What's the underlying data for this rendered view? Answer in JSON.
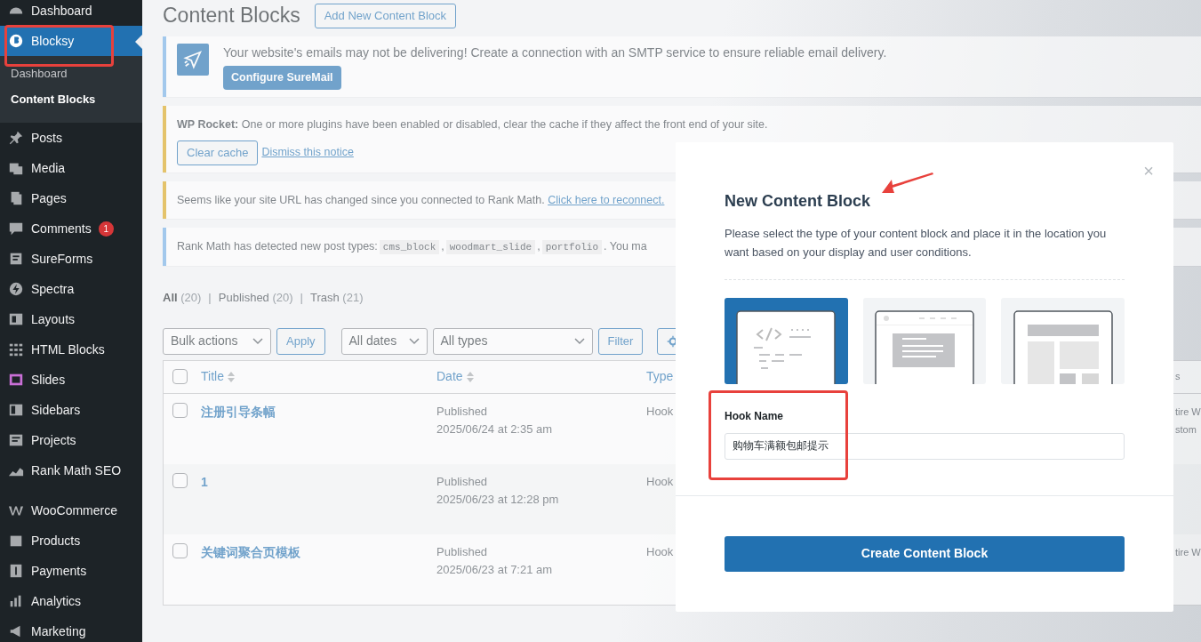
{
  "sidebar": {
    "menu_groups": [
      [
        {
          "label": "Dashboard",
          "selected": false,
          "highlighted": false
        },
        {
          "label": "Blocksy",
          "selected": true,
          "highlighted": true,
          "children": [
            {
              "label": "Dashboard",
              "selected": false
            },
            {
              "label": "Content Blocks",
              "selected": true
            }
          ]
        },
        {
          "label": "Posts",
          "selected": false,
          "highlighted": false
        },
        {
          "label": "Media",
          "selected": false,
          "highlighted": false
        },
        {
          "label": "Pages",
          "selected": false,
          "highlighted": false
        },
        {
          "label": "Comments",
          "selected": false,
          "highlighted": false,
          "badge": "1"
        },
        {
          "label": "SureForms",
          "selected": false,
          "highlighted": false
        },
        {
          "label": "Spectra",
          "selected": false,
          "highlighted": false
        },
        {
          "label": "Layouts",
          "selected": false,
          "highlighted": false
        },
        {
          "label": "HTML Blocks",
          "selected": false,
          "highlighted": false
        },
        {
          "label": "Slides",
          "selected": false,
          "highlighted": false
        },
        {
          "label": "Sidebars",
          "selected": false,
          "highlighted": false
        },
        {
          "label": "Projects",
          "selected": false,
          "highlighted": false
        },
        {
          "label": "Rank Math SEO",
          "selected": false,
          "highlighted": false
        }
      ],
      [
        {
          "label": "WooCommerce",
          "selected": false,
          "highlighted": false
        },
        {
          "label": "Products",
          "selected": false,
          "highlighted": false
        },
        {
          "label": "Payments",
          "selected": false,
          "highlighted": false
        },
        {
          "label": "Analytics",
          "selected": false,
          "highlighted": false
        },
        {
          "label": "Marketing",
          "selected": false,
          "highlighted": false
        }
      ]
    ]
  },
  "page": {
    "title": "Content Blocks",
    "add_button": "Add New Content Block"
  },
  "notices": [
    {
      "warning": false,
      "kind": "suremail",
      "text": "Your website's emails may not be delivering! Create a connection with an SMTP service to ensure reliable email delivery.",
      "button": "Configure SureMail"
    },
    {
      "warning": true,
      "kind": "actions",
      "text": "**WP Rocket:** One or more plugins have been enabled or disabled, clear the cache if they affect the front end of your site.",
      "button": "Clear cache",
      "link": "Dismiss this notice"
    },
    {
      "warning": true,
      "kind": "text",
      "text": "Seems like your site URL has changed since you connected to Rank Math.",
      "link": "Click here to reconnect."
    },
    {
      "warning": false,
      "kind": "segments",
      "segments": [
        {
          "kind": "text",
          "text": "Rank Math has detected new post types:"
        },
        {
          "kind": "code",
          "text": "cms_block"
        },
        {
          "kind": "text",
          "text": ","
        },
        {
          "kind": "code",
          "text": "woodmart_slide"
        },
        {
          "kind": "text",
          "text": ","
        },
        {
          "kind": "code",
          "text": "portfolio"
        },
        {
          "kind": "text",
          "text": ". You ma"
        }
      ]
    }
  ],
  "views": [
    {
      "label": "All",
      "count": "(20)",
      "selected": true
    },
    {
      "separator": "|",
      "label": "Published",
      "count": "(20)",
      "selected": false
    },
    {
      "separator": "|",
      "label": "Trash",
      "count": "(21)",
      "selected": false
    }
  ],
  "toolbar": [
    {
      "kind": "select",
      "label": "Bulk actions"
    },
    {
      "kind": "button",
      "label": "Apply"
    },
    {
      "kind": "select",
      "label": "All dates"
    },
    {
      "kind": "select",
      "label": "All types"
    },
    {
      "kind": "button",
      "label": "Filter"
    },
    {
      "kind": "gear"
    }
  ],
  "table": {
    "select_all_checked": false,
    "columns": [
      {
        "label": "Title",
        "sortable": true
      },
      {
        "label": "Date",
        "sortable": true
      },
      {
        "label": "Type",
        "sortable": false
      },
      {
        "label": "s",
        "sortable": false
      }
    ],
    "rows": [
      {
        "checked": false,
        "title": "注册引导条幅",
        "status": "Published",
        "date": "2025/06/24 at 2:35 am",
        "type": "Hook",
        "column_4": [
          "tire W",
          "stom"
        ]
      },
      {
        "checked": false,
        "title": "1",
        "status": "Published",
        "date": "2025/06/23 at 12:28 pm",
        "type": "Hook",
        "column_4": []
      },
      {
        "checked": false,
        "title": "关键词聚合页模板",
        "status": "Published",
        "date": "2025/06/23 at 7:21 am",
        "type": "Hook",
        "column_4": [
          "tire W"
        ]
      }
    ]
  },
  "modal": {
    "close": "×",
    "title": "New Content Block",
    "description": "Please select the type of your content block and place it in the location you want based on your display and user conditions.",
    "block_types": [
      {
        "selected": true
      },
      {
        "selected": false
      },
      {
        "selected": false
      }
    ],
    "field": {
      "label": "Hook Name",
      "value": "购物车满额包邮提示",
      "highlighted": true
    },
    "submit": "Create Content Block"
  },
  "annotations": [
    {
      "kind": "arrow"
    }
  ]
}
